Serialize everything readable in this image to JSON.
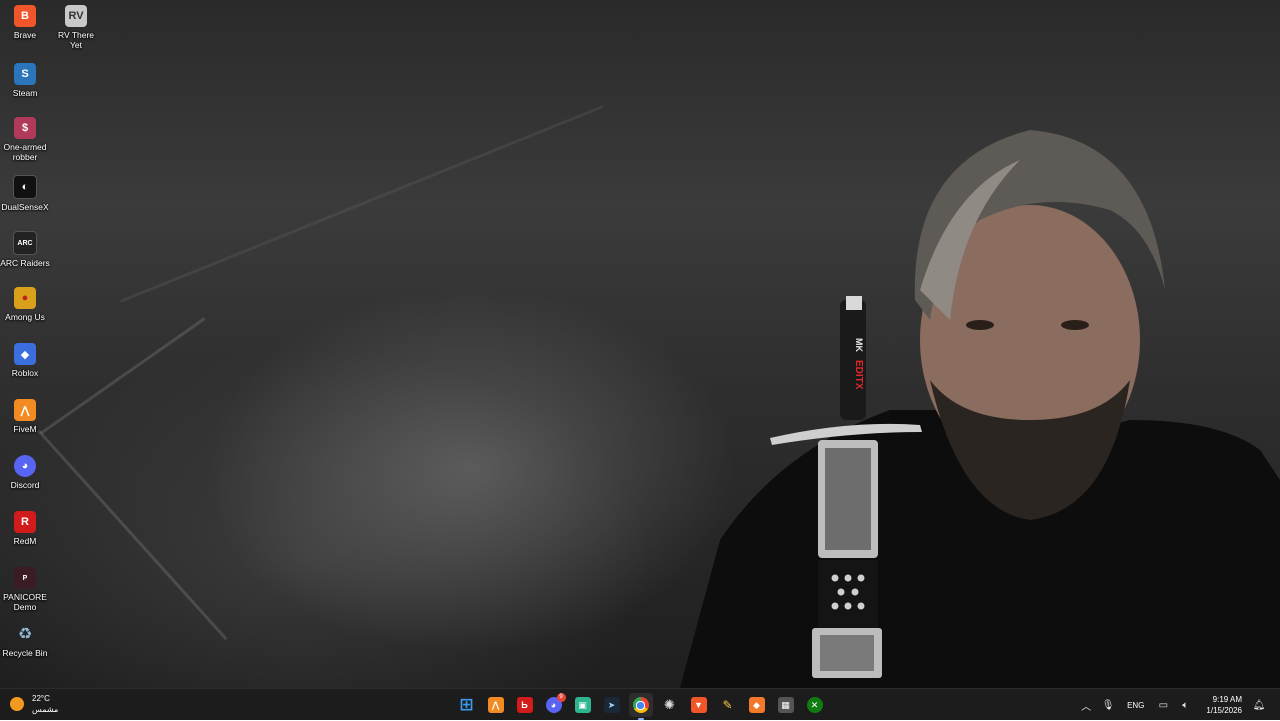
{
  "desktop": {
    "icons": [
      {
        "label": "Brave",
        "icon": "brave-icon",
        "color": "#f1562b"
      },
      {
        "label": "RV There Yet",
        "icon": "rv-there-yet-icon",
        "color": "#c9c9c9"
      },
      {
        "label": "Steam",
        "icon": "steam-icon",
        "color": "#2a75bb"
      },
      {
        "label": "One-armed robber",
        "icon": "one-armed-robber-icon",
        "color": "#b03a57"
      },
      {
        "label": "DualSenseX",
        "icon": "dualsensex-icon",
        "color": "#111111"
      },
      {
        "label": "ARC Raiders",
        "icon": "arc-raiders-icon",
        "color": "#222222"
      },
      {
        "label": "Among Us",
        "icon": "among-us-icon",
        "color": "#d8a01b"
      },
      {
        "label": "Roblox",
        "icon": "roblox-icon",
        "color": "#3b6fe0"
      },
      {
        "label": "FiveM",
        "icon": "fivem-icon",
        "color": "#f28b22"
      },
      {
        "label": "Discord",
        "icon": "discord-icon",
        "color": "#5865f2"
      },
      {
        "label": "RedM",
        "icon": "redm-icon",
        "color": "#d21c1c"
      },
      {
        "label": "PANICORE Demo",
        "icon": "panicore-icon",
        "color": "#3a1d24"
      },
      {
        "label": "Recycle Bin",
        "icon": "recycle-bin-icon",
        "color": "#8fb7d6"
      }
    ]
  },
  "wallpaper": {
    "sword_text_1": "MK",
    "sword_text_2": "EDITX"
  },
  "taskbar": {
    "weather": {
      "temp": "22°C",
      "condition": "مشمس",
      "icon": "sun-icon",
      "color": "#f29a1f"
    },
    "apps": [
      {
        "name": "start",
        "icon": "windows-start-icon",
        "color": "#3a9bf0",
        "glyph": "⊞"
      },
      {
        "name": "app-orange",
        "icon": "fivem-icon",
        "color": "#f28b22",
        "glyph": "⋀"
      },
      {
        "name": "app-red",
        "icon": "redm-icon",
        "color": "#d21c1c",
        "glyph": "Ь"
      },
      {
        "name": "discord",
        "icon": "discord-icon",
        "color": "#5865f2",
        "glyph": "◕",
        "badge": "9"
      },
      {
        "name": "app-teal",
        "icon": "teal-app-icon",
        "color": "#2fb58e",
        "glyph": "▣"
      },
      {
        "name": "steam",
        "icon": "steam-icon",
        "color": "#1b2838",
        "glyph": "➤"
      },
      {
        "name": "chrome",
        "icon": "chrome-icon",
        "color": "#4285f4",
        "glyph": "●",
        "active": true
      },
      {
        "name": "steelseries",
        "icon": "steelseries-icon",
        "color": "#444444",
        "glyph": "✺"
      },
      {
        "name": "brave",
        "icon": "brave-icon",
        "color": "#f1562b",
        "glyph": "▼"
      },
      {
        "name": "pen-app",
        "icon": "pen-app-icon",
        "color": "#444444",
        "glyph": "✎"
      },
      {
        "name": "app-box",
        "icon": "orange-box-icon",
        "color": "#f2792a",
        "glyph": "◆"
      },
      {
        "name": "store",
        "icon": "microsoft-store-icon",
        "color": "#555555",
        "glyph": "▦"
      },
      {
        "name": "xbox",
        "icon": "xbox-icon",
        "color": "#107c10",
        "glyph": "✕"
      }
    ],
    "tray": {
      "chevron_icon": "chevron-up-icon",
      "mic_icon": "microphone-icon",
      "language": "ENG",
      "network_icon": "network-icon",
      "volume_icon": "volume-icon",
      "time": "9:19 AM",
      "date": "1/15/2026",
      "notify_icon": "notification-icon"
    }
  }
}
